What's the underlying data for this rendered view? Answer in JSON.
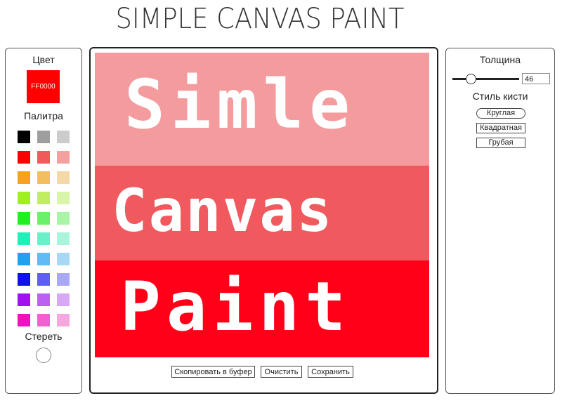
{
  "title": "SIMPLE CANVAS PAINT",
  "left": {
    "color_label": "Цвет",
    "current_color": "FF0000",
    "palette_label": "Палитра",
    "eraser_label": "Стереть",
    "palette": [
      [
        "#000000",
        "#9E9E9E",
        "#CCCCCC"
      ],
      [
        "#FF0000",
        "#F05A5A",
        "#F5A0A0"
      ],
      [
        "#F8A020",
        "#F2BE60",
        "#F5D8A8"
      ],
      [
        "#A0F020",
        "#C0EE60",
        "#D8F5A8"
      ],
      [
        "#20F020",
        "#6AF06A",
        "#A8F5A8"
      ],
      [
        "#20F0B8",
        "#6AF0C8",
        "#A8F5DC"
      ],
      [
        "#20A0F0",
        "#60BCF2",
        "#A8D8F5"
      ],
      [
        "#1010F0",
        "#6060F0",
        "#A8A8F5"
      ],
      [
        "#A010F0",
        "#BC60F2",
        "#D8A8F5"
      ],
      [
        "#F010C0",
        "#F060D0",
        "#F5A8E0"
      ]
    ]
  },
  "canvas": {
    "line1": "Simle",
    "line2": "Canvas",
    "line3": "Paint",
    "band_colors": [
      "#F49B9E",
      "#F05A5F",
      "#FF0018"
    ]
  },
  "bottom_buttons": {
    "copy": "Скопировать в буфер",
    "clear": "Очистить",
    "save": "Сохранить"
  },
  "right": {
    "thickness_label": "Толщина",
    "thickness_value": "46",
    "brush_style_label": "Стиль кисти",
    "brushes": [
      "Круглая",
      "Квадратная",
      "Грубая"
    ]
  }
}
